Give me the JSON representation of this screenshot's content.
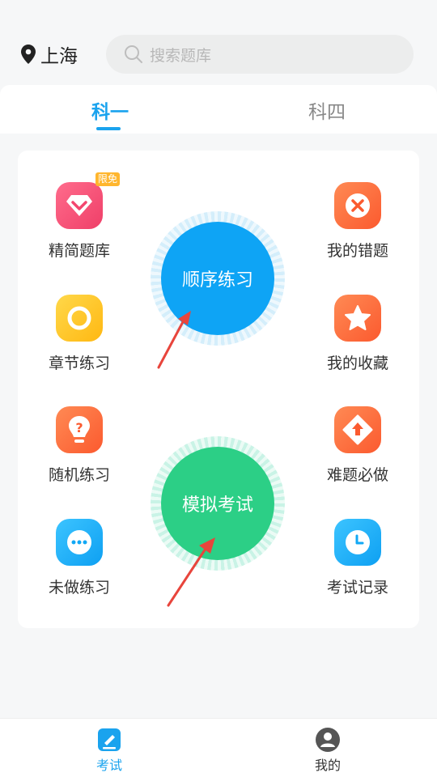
{
  "header": {
    "city": "上海",
    "search_placeholder": "搜索题库"
  },
  "tabs": [
    {
      "label": "科一",
      "active": true
    },
    {
      "label": "科四",
      "active": false
    }
  ],
  "grid": {
    "items": [
      {
        "label": "精简题库",
        "icon": "diamond-icon",
        "badge": "限免"
      },
      {
        "label": "章节练习",
        "icon": "ring-icon"
      },
      {
        "label": "随机练习",
        "icon": "question-bulb-icon"
      },
      {
        "label": "未做练习",
        "icon": "dots-icon"
      },
      {
        "label": "我的错题",
        "icon": "close-circle-icon"
      },
      {
        "label": "我的收藏",
        "icon": "star-icon"
      },
      {
        "label": "难题必做",
        "icon": "arrow-up-diamond-icon"
      },
      {
        "label": "考试记录",
        "icon": "clock-icon"
      }
    ],
    "center_buttons": [
      {
        "label": "顺序练习",
        "color": "#0ea4f5"
      },
      {
        "label": "模拟考试",
        "color": "#2ccf86"
      }
    ]
  },
  "bottom_nav": [
    {
      "label": "考试",
      "icon": "exam-icon",
      "active": true
    },
    {
      "label": "我的",
      "icon": "profile-icon",
      "active": false
    }
  ],
  "colors": {
    "accent": "#1aa3ee",
    "pink": "#f3466e",
    "orange": "#ff6a3b",
    "yellow": "#ffc61e",
    "blue": "#11a8f5",
    "green": "#2ccf86",
    "annotation_arrow": "#e8453c"
  }
}
